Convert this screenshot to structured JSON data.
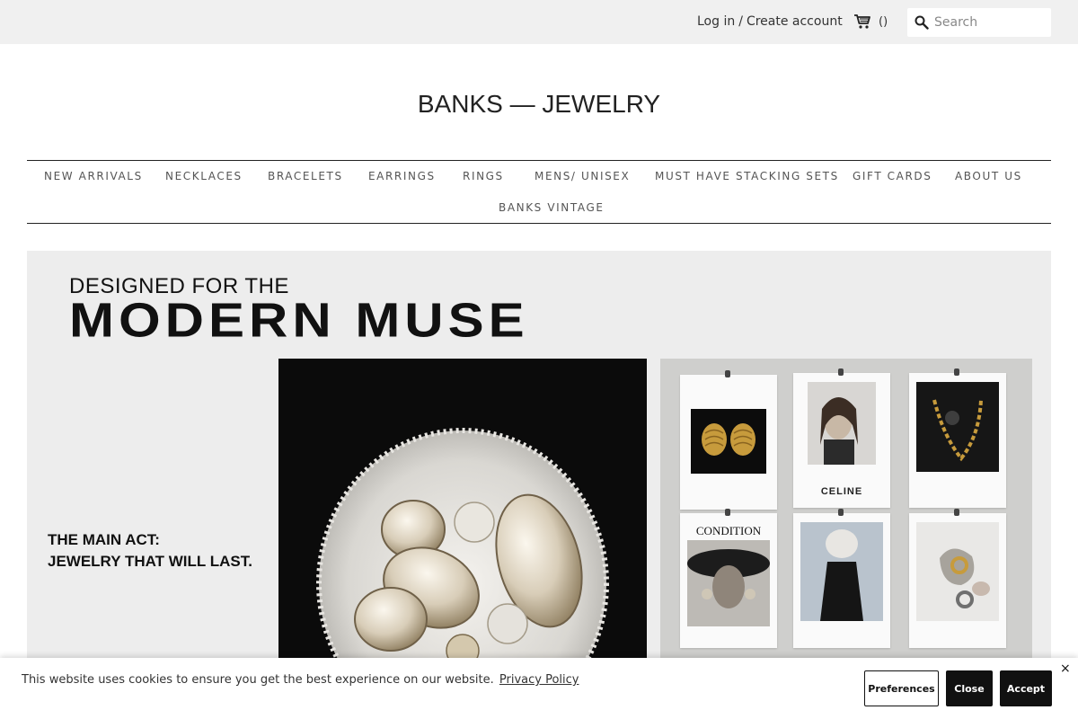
{
  "header": {
    "login_label": "Log in",
    "separator": "/",
    "create_account_label": "Create account",
    "cart_count": "()",
    "search_placeholder": "Search"
  },
  "logo": {
    "text": "BANKS — JEWELRY"
  },
  "nav": {
    "items": [
      "NEW ARRIVALS",
      "NECKLACES",
      "BRACELETS",
      "EARRINGS",
      "RINGS",
      "MENS/ UNISEX",
      "MUST HAVE STACKING SETS",
      "GIFT CARDS",
      "ABOUT US",
      "BANKS VINTAGE"
    ]
  },
  "hero": {
    "kicker": "DESIGNED FOR THE",
    "title": "MODERN MUSE",
    "tagline_line1": "THE MAIN ACT:",
    "tagline_line2": "JEWELRY THAT WILL LAST.",
    "card_captions": {
      "celine": "CELINE",
      "condition": "CONDITION"
    }
  },
  "cookie": {
    "message": "This website uses cookies to ensure you get the best experience on our website.",
    "policy_link": "Privacy Policy",
    "preferences_label": "Preferences",
    "close_label": "Close",
    "accept_label": "Accept",
    "dismiss_glyph": "×"
  },
  "colors": {
    "topbar_bg": "#f0f0f0",
    "text": "#333333",
    "button_dark": "#111111",
    "hero_bg": "#ededed"
  }
}
